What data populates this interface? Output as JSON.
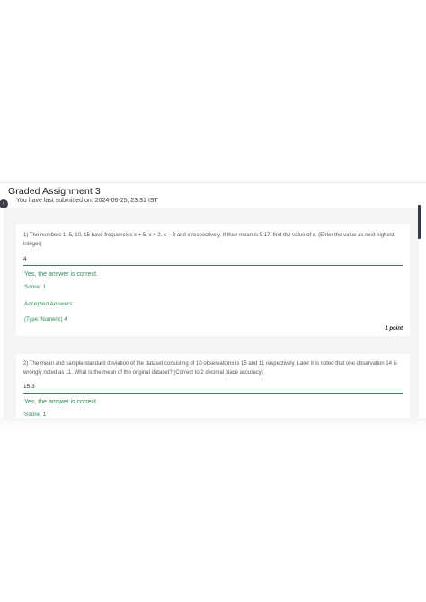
{
  "page": {
    "title": "Graded Assignment 3",
    "submitted_text": "You have last submitted on: 2024-06-25, 23:31 IST",
    "back_icon_glyph": "‹"
  },
  "questions": [
    {
      "text": "1) The numbers 1, 5, 10, 15 have frequencies x + 5, x + 2, x − 3 and x respectively. If their mean is 5.17, find the value of x. (Enter the value as next highest integer)",
      "answer": "4",
      "status": "Yes, the answer is correct.",
      "score": "Score: 1",
      "accepted_title": "Accepted Answers:",
      "accepted_value": "(Type: Numeric) 4",
      "points": "1 point"
    },
    {
      "text": "2) The mean and sample standard deviation of the dataset consisting of 10 observations is 15 and 11 respectively. Later it is noted that one observation 14 is wrongly noted as 11. What is the mean of the original dataset? (Correct to 2 decimal place accuracy)",
      "answer": "15.3",
      "status": "Yes, the answer is correct.",
      "score": "Score: 1"
    }
  ],
  "colors": {
    "accent": "#2e8b57",
    "background": "#f4f4f4",
    "card": "#ffffff"
  }
}
